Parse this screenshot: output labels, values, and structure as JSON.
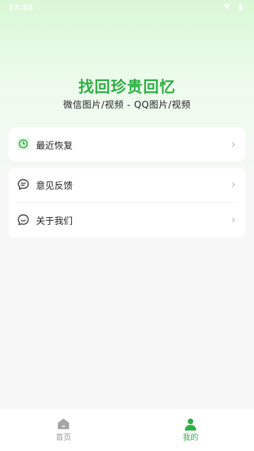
{
  "status": {
    "time": "12:55",
    "icons": "♥ ▮"
  },
  "hero": {
    "title": "找回珍贵回忆",
    "subtitle": "微信图片/视频 - QQ图片/视频"
  },
  "menu": {
    "recent": {
      "label": "最近恢复",
      "icon": "clock-icon"
    },
    "feedback": {
      "label": "意见反馈",
      "icon": "chat-bubble-icon"
    },
    "about": {
      "label": "关于我们",
      "icon": "smile-bubble-icon"
    }
  },
  "chevron": "›",
  "tabs": [
    {
      "label": "首页",
      "icon": "home-icon",
      "active": false
    },
    {
      "label": "我的",
      "icon": "user-icon",
      "active": true
    }
  ],
  "colors": {
    "accent": "#2eae45",
    "inactive": "#9a9a9a"
  }
}
